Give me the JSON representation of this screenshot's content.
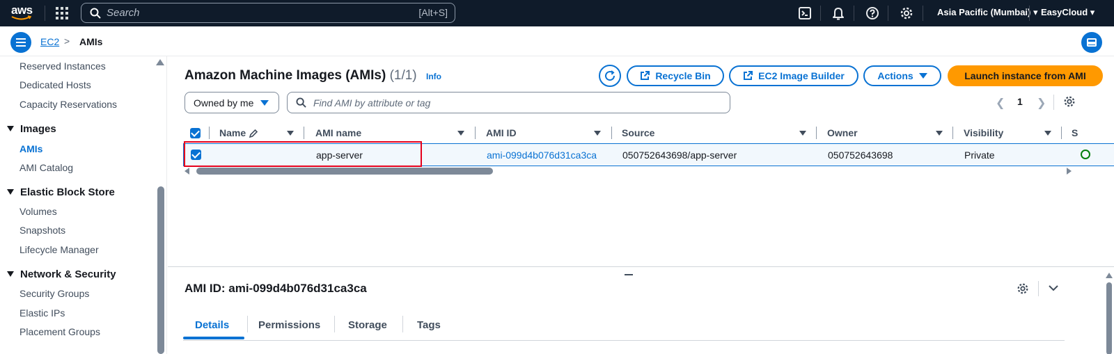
{
  "topnav": {
    "logo": "aws",
    "search_placeholder": "Search",
    "search_shortcut": "[Alt+S]",
    "region": "Asia Pacific (Mumbai) ▾",
    "account": "EasyCloud ▾"
  },
  "breadcrumb": {
    "root": "EC2",
    "separator": ">",
    "current": "AMIs"
  },
  "sidebar": {
    "items_top": [
      "Reserved Instances",
      "Dedicated Hosts",
      "Capacity Reservations"
    ],
    "sections": [
      {
        "title": "Images",
        "items": [
          "AMIs",
          "AMI Catalog"
        ]
      },
      {
        "title": "Elastic Block Store",
        "items": [
          "Volumes",
          "Snapshots",
          "Lifecycle Manager"
        ]
      },
      {
        "title": "Network & Security",
        "items": [
          "Security Groups",
          "Elastic IPs",
          "Placement Groups"
        ]
      }
    ],
    "active_item": "AMIs"
  },
  "main": {
    "title": "Amazon Machine Images (AMIs)",
    "count": "(1/1)",
    "info": "Info",
    "buttons": {
      "recycle_bin": "Recycle Bin",
      "image_builder": "EC2 Image Builder",
      "actions": "Actions",
      "launch": "Launch instance from AMI"
    },
    "filter_select": "Owned by me",
    "find_placeholder": "Find AMI by attribute or tag",
    "page": "1",
    "columns": [
      "Name",
      "AMI name",
      "AMI ID",
      "Source",
      "Owner",
      "Visibility",
      "S"
    ],
    "rows": [
      {
        "name": "",
        "ami_name": "app-server",
        "ami_id": "ami-099d4b076d31ca3ca",
        "source": "050752643698/app-server",
        "owner": "050752643698",
        "visibility": "Private"
      }
    ]
  },
  "details": {
    "title": "AMI ID: ami-099d4b076d31ca3ca",
    "tabs": [
      "Details",
      "Permissions",
      "Storage",
      "Tags"
    ],
    "active_tab": "Details"
  },
  "colors": {
    "accent": "#0972d3",
    "launch": "#ff9900",
    "nav": "#0f1b2a",
    "highlight": "#e5001c"
  }
}
